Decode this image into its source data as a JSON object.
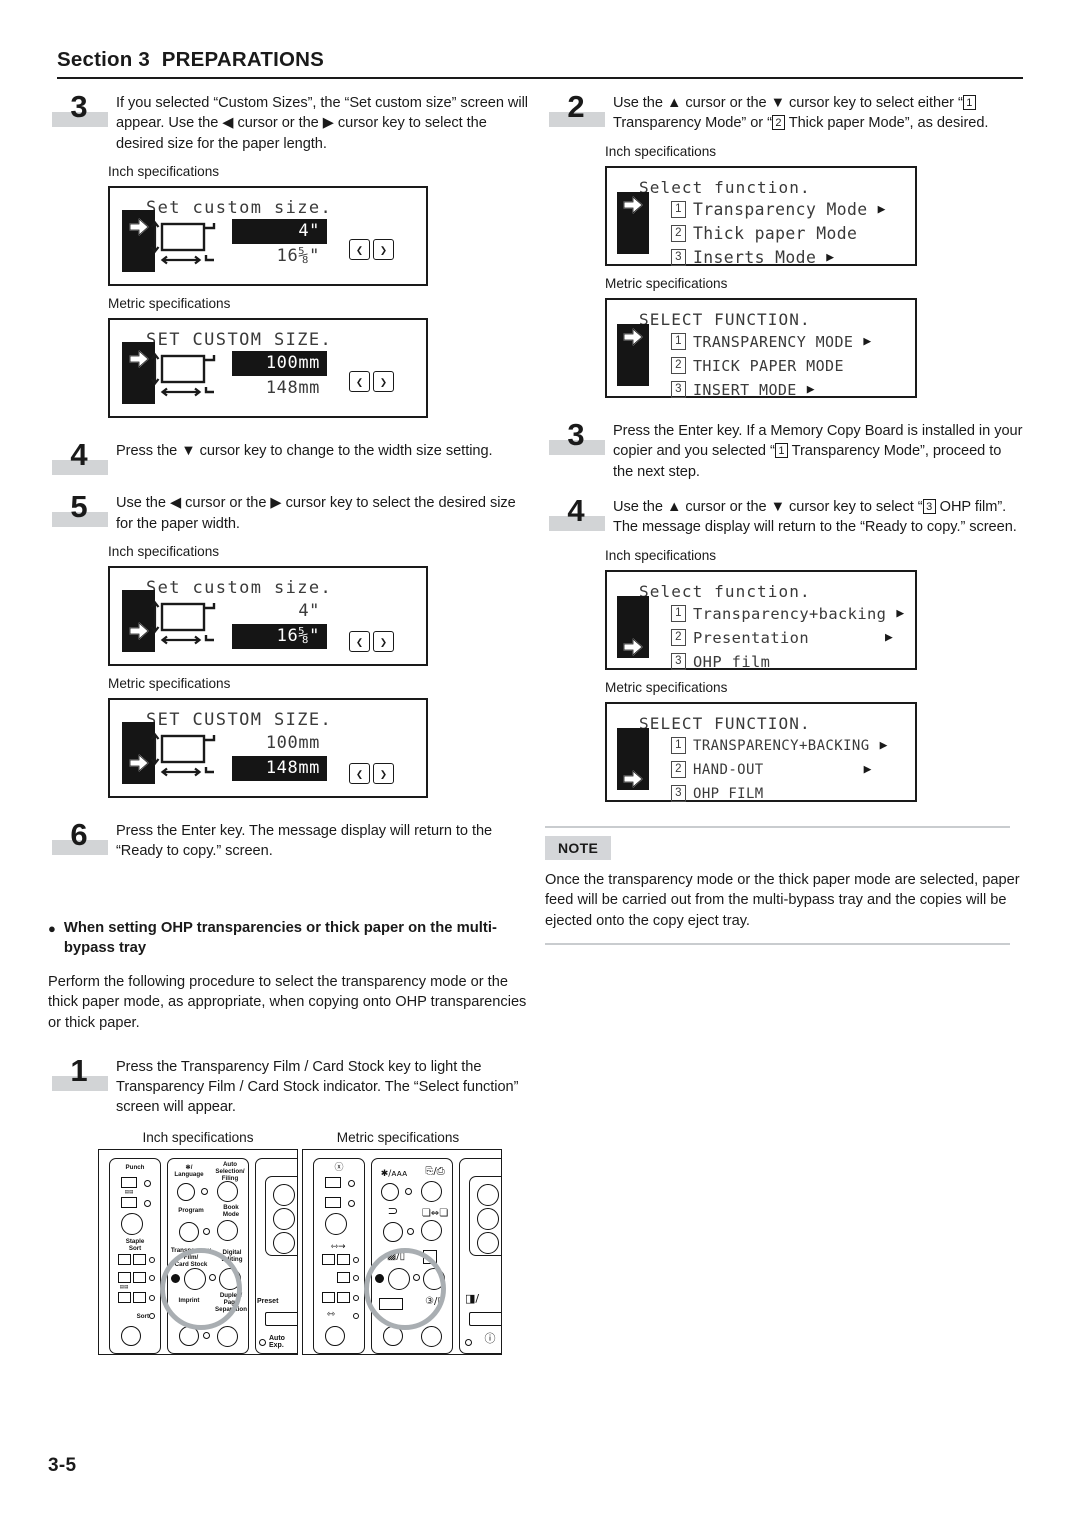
{
  "header": {
    "section_label": "Section 3",
    "title": "PREPARATIONS"
  },
  "footer": {
    "page_number": "3-5"
  },
  "left_column": {
    "step3": {
      "number": "3",
      "text_parts": {
        "a": "If you selected “Custom Sizes”, the “Set custom size” screen will appear. Use the ◀ cursor or the ▶ cursor key to select the desired size for the paper length."
      }
    },
    "step3_inch_caption": "Inch specifications",
    "step3_inch_lcd": {
      "title": "Set custom size.",
      "length_value": "4\"",
      "width_value": "16⅝\"",
      "highlight": "length",
      "left_key": "❮",
      "right_key": "❯"
    },
    "step3_metric_caption": "Metric specifications",
    "step3_metric_lcd": {
      "title": "SET CUSTOM SIZE.",
      "length_value": "100mm",
      "width_value": "148mm",
      "highlight": "length",
      "left_key": "❮",
      "right_key": "❯"
    },
    "step4": {
      "number": "4",
      "text": "Press the ▼ cursor key to change to the width size setting."
    },
    "step5": {
      "number": "5",
      "text": "Use the ◀ cursor or the ▶ cursor key to select the desired size for the paper width."
    },
    "step5_inch_caption": "Inch specifications",
    "step5_inch_lcd": {
      "title": "Set custom size.",
      "length_value": "4\"",
      "width_value": "16⅝\"",
      "highlight": "width",
      "left_key": "❮",
      "right_key": "❯"
    },
    "step5_metric_caption": "Metric specifications",
    "step5_metric_lcd": {
      "title": "SET CUSTOM SIZE.",
      "length_value": "100mm",
      "width_value": "148mm",
      "highlight": "width",
      "left_key": "❮",
      "right_key": "❯"
    },
    "step6": {
      "number": "6",
      "text": "Press the Enter key. The message display will return to the “Ready to copy.” screen."
    },
    "bullet_heading": "When setting OHP transparencies or thick paper on the multi-bypass tray",
    "bullet_paragraph": "Perform the following procedure to select the transparency mode or the thick paper mode, as appropriate, when copying onto OHP transparencies or thick paper.",
    "step1": {
      "number": "1",
      "text": "Press the Transparency Film / Card Stock key to light the Transparency Film / Card Stock indicator. The “Select function” screen will appear."
    },
    "panel_captions": {
      "inch": "Inch specifications",
      "metric": "Metric specifications"
    },
    "control_panel_inch": {
      "labels": [
        "Punch",
        "Staple Sort",
        "Sort",
        "Language",
        "Program",
        "Transparency Film/ Card Stock",
        "Imprint",
        "Auto Selection/ Filing",
        "Book Mode",
        "Digital Editing",
        "Duplex/ Page Separation",
        "Preset",
        "Auto Exp."
      ],
      "language_prefix": "✻/"
    },
    "control_panel_metric": {
      "icons": [
        "✻/ᴀᴀᴀ",
        "❐/❑",
        "⊃",
        "❋═❋",
        "▨/❐",
        "⊡",
        "②/❑",
        "◨/",
        "ⓘ"
      ]
    }
  },
  "right_column": {
    "step2": {
      "number": "2",
      "pre": "Use the ▲ cursor or the ▼ cursor key to select either “",
      "key1": "1",
      "mid": " Transparency Mode” or “",
      "key2": "2",
      "post": " Thick paper Mode”, as desired."
    },
    "step2_inch_caption": "Inch specifications",
    "step2_inch_lcd": {
      "title": "Select function.",
      "items": [
        {
          "idx": "1",
          "label": "Transparency Mode",
          "arrow": true
        },
        {
          "idx": "2",
          "label": "Thick paper Mode",
          "arrow": false
        },
        {
          "idx": "3",
          "label": "Inserts Mode",
          "arrow": true
        }
      ],
      "cursor_row": 1
    },
    "step2_metric_caption": "Metric specifications",
    "step2_metric_lcd": {
      "title": "SELECT FUNCTION.",
      "items": [
        {
          "idx": "1",
          "label": "TRANSPARENCY MODE",
          "arrow": true
        },
        {
          "idx": "2",
          "label": "THICK PAPER MODE",
          "arrow": false
        },
        {
          "idx": "3",
          "label": "INSERT MODE",
          "arrow": true
        }
      ],
      "cursor_row": 1
    },
    "step3": {
      "number": "3",
      "pre": "Press the Enter key. If a Memory Copy Board is installed in your copier and you selected “",
      "key1": "1",
      "post": " Transparency Mode”, proceed to the next step."
    },
    "step4": {
      "number": "4",
      "pre": "Use the ▲ cursor or the ▼ cursor key to select “",
      "key1": "3",
      "post": " OHP film”. The message display will return to the “Ready to copy.” screen."
    },
    "step4_inch_caption": "Inch specifications",
    "step4_inch_lcd": {
      "title": "Select function.",
      "items": [
        {
          "idx": "1",
          "label": "Transparency+backing",
          "arrow": true
        },
        {
          "idx": "2",
          "label": "Presentation",
          "arrow": true
        },
        {
          "idx": "3",
          "label": "OHP film",
          "arrow": false
        }
      ],
      "cursor_row": 3
    },
    "step4_metric_caption": "Metric specifications",
    "step4_metric_lcd": {
      "title": "SELECT FUNCTION.",
      "items": [
        {
          "idx": "1",
          "label": "TRANSPARENCY+BACKING",
          "arrow": true
        },
        {
          "idx": "2",
          "label": "HAND-OUT",
          "arrow": true
        },
        {
          "idx": "3",
          "label": "OHP FILM",
          "arrow": false
        }
      ],
      "cursor_row": 3
    },
    "note": {
      "tag": "NOTE",
      "body": "Once the transparency mode or the thick paper mode are selected, paper feed will be carried out from the multi-bypass tray and the copies will be ejected onto the copy eject tray."
    }
  },
  "colors": {
    "ink": "#1a1a1a",
    "lcd_text": "#3a3a3a",
    "highlight_bg": "#151515",
    "step_bar": "#d2d4d6",
    "note_rule": "#c9cccf",
    "note_tag_bg": "#d4d6d9",
    "callout_ring": "#a9aeb2"
  }
}
